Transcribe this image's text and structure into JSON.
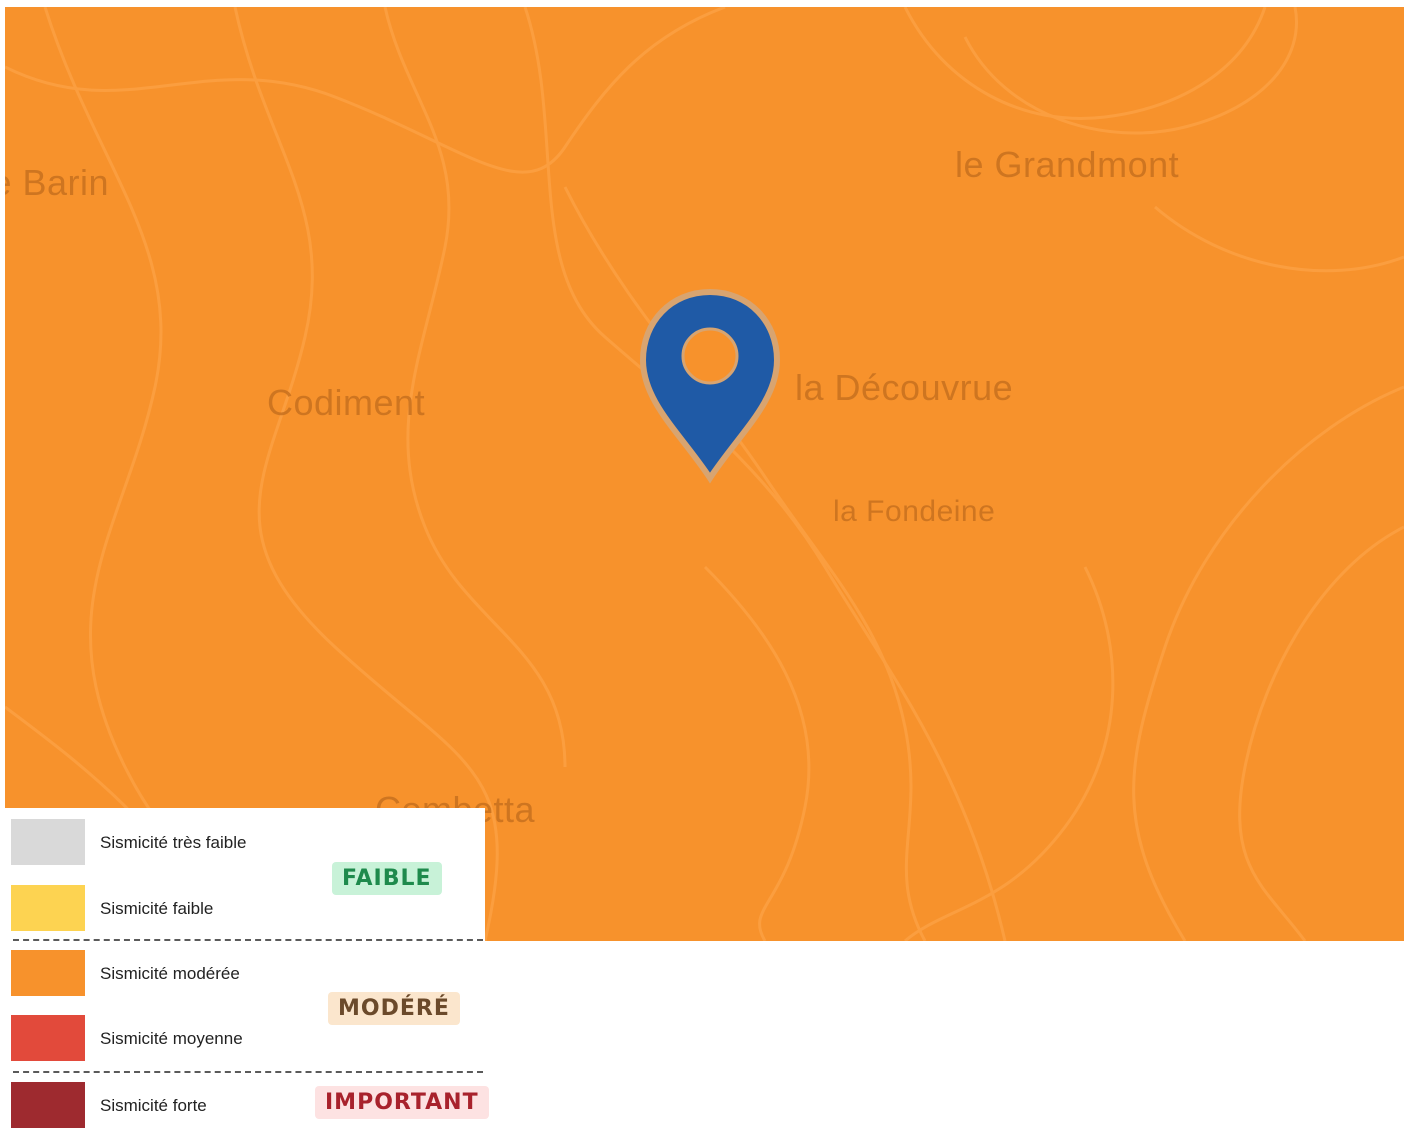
{
  "map": {
    "background": "#f7922c",
    "places": [
      {
        "id": "le-barin",
        "label": "le Barin"
      },
      {
        "id": "le-grandmont",
        "label": "le Grandmont"
      },
      {
        "id": "codiment",
        "label": "Codiment"
      },
      {
        "id": "la-decouvrue",
        "label": "la Découvrue"
      },
      {
        "id": "la-fondeine",
        "label": "la Fondeine"
      },
      {
        "id": "la-combetta",
        "label": "Combetta"
      }
    ],
    "marker": {
      "icon": "location-pin-icon",
      "color": "#1f5aa6"
    }
  },
  "legend": {
    "levels": [
      {
        "label": "Sismicité très faible",
        "color": "#d9d9d9"
      },
      {
        "label": "Sismicité faible",
        "color": "#fdd351"
      },
      {
        "label": "Sismicité modérée",
        "color": "#f7922c"
      },
      {
        "label": "Sismicité moyenne",
        "color": "#e24a3b"
      },
      {
        "label": "Sismicité forte",
        "color": "#9e2a2f"
      }
    ],
    "categories": [
      {
        "label": "FAIBLE",
        "color": "#1e8a4c",
        "bg": "#c8f2d8"
      },
      {
        "label": "MODÉRÉ",
        "color": "#6b4a2b",
        "bg": "#fbe6cd"
      },
      {
        "label": "IMPORTANT",
        "color": "#a8222c",
        "bg": "#fde2e2"
      }
    ]
  }
}
